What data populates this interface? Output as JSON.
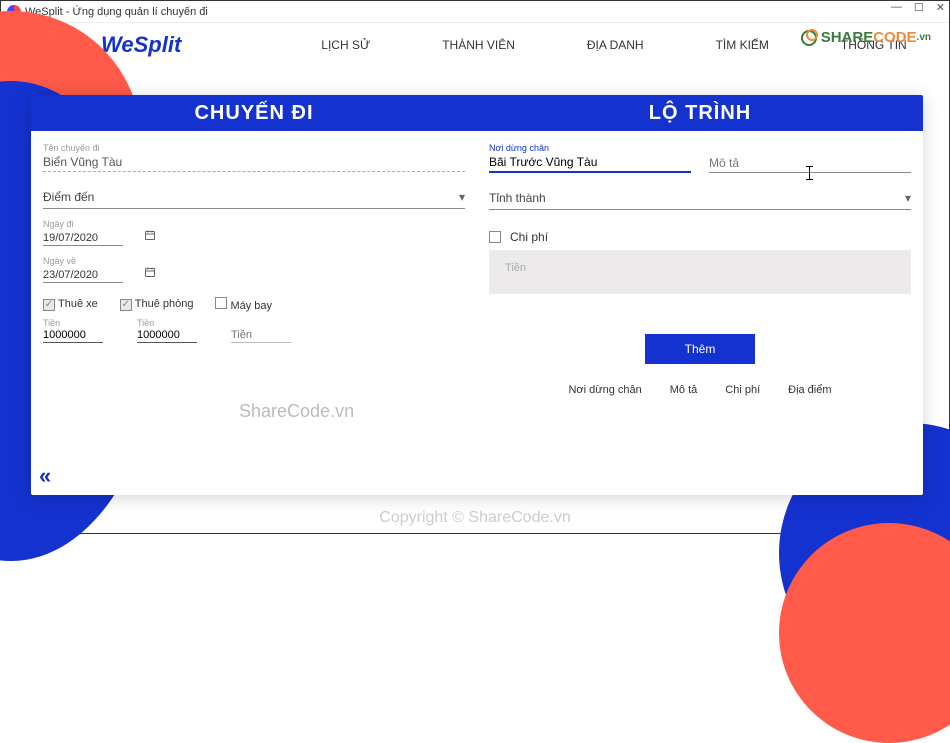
{
  "window": {
    "title": "WeSplit - Ứng dụng quản lí chuyến đi"
  },
  "header": {
    "logo": "WeSplit",
    "nav": [
      "LỊCH SỬ",
      "THÀNH VIÊN",
      "ĐỊA DANH",
      "TÌM KIẾM",
      "THÔNG TIN"
    ],
    "sharecode": {
      "green": "SHARE",
      "orange": "CODE",
      "suffix": ".vn"
    }
  },
  "sections": {
    "left": "CHUYẾN ĐI",
    "right": "LỘ TRÌNH"
  },
  "left": {
    "trip_name_label": "Tên chuyến đi",
    "trip_name_value": "Biển Vũng Tàu",
    "destination_label": "Điểm đến",
    "depart_label": "Ngày đi",
    "depart_value": "19/07/2020",
    "return_label": "Ngày về",
    "return_value": "23/07/2020",
    "cb_rent_car": "Thuê xe",
    "cb_rent_room": "Thuê phòng",
    "cb_plane": "Máy bay",
    "money_label": "Tiền",
    "money_car": "1000000",
    "money_room": "1000000",
    "money_plane_placeholder": "Tiền"
  },
  "right": {
    "stop_label": "Nơi dừng chân",
    "stop_value": "Bãi Trước Vũng Tàu",
    "desc_label": "Mô tả",
    "province_label": "Tỉnh thành",
    "cost_label": "Chi phí",
    "money_placeholder": "Tiền",
    "add_button": "Thêm",
    "tabs": [
      "Nơi dừng chân",
      "Mô tả",
      "Chi phí",
      "Địa điểm"
    ]
  },
  "watermarks": {
    "mid": "ShareCode.vn",
    "bottom": "Copyright © ShareCode.vn"
  }
}
